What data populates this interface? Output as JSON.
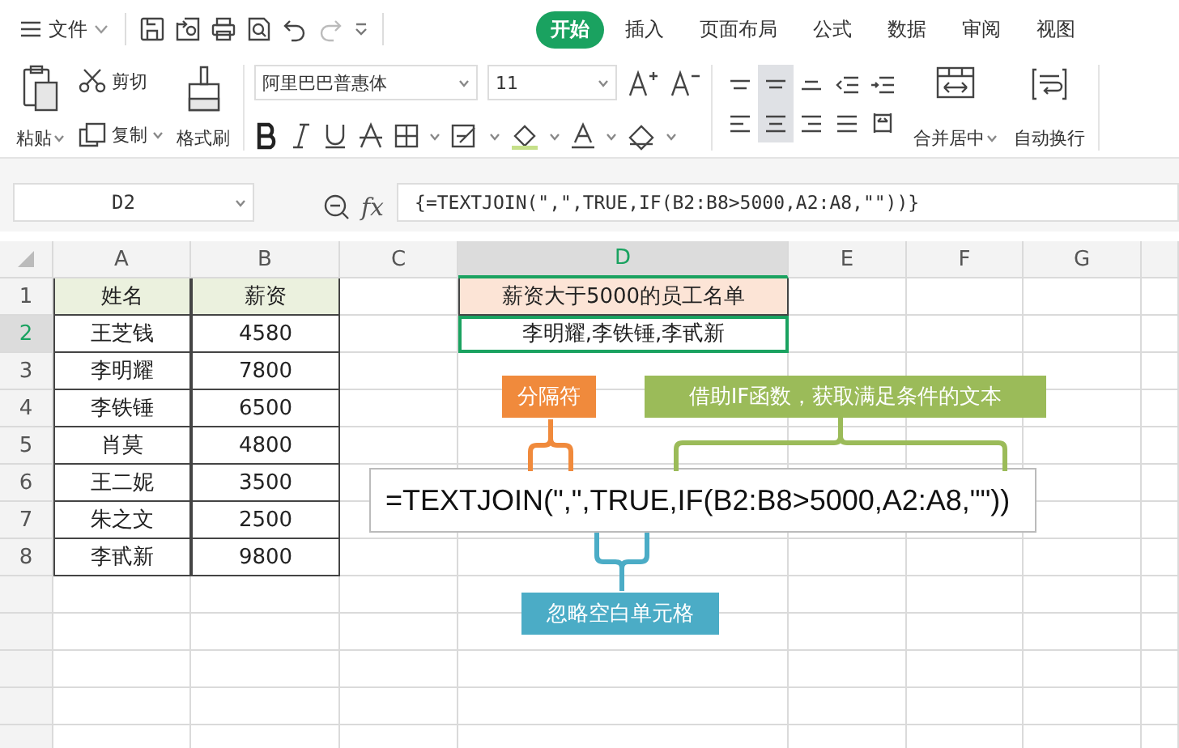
{
  "menu": {
    "file_label": "文件",
    "tabs": [
      {
        "label": "开始",
        "selected": true
      },
      {
        "label": "插入",
        "selected": false
      },
      {
        "label": "页面布局",
        "selected": false
      },
      {
        "label": "公式",
        "selected": false
      },
      {
        "label": "数据",
        "selected": false
      },
      {
        "label": "审阅",
        "selected": false
      },
      {
        "label": "视图",
        "selected": false
      }
    ]
  },
  "ribbon": {
    "paste": "粘贴",
    "cut": "剪切",
    "copy": "复制",
    "format_painter": "格式刷",
    "font_name": "阿里巴巴普惠体",
    "font_size": "11",
    "merge": "合并居中",
    "wrap": "自动换行",
    "align_buttons": [
      {
        "kind": "top",
        "selected": false
      },
      {
        "kind": "middle",
        "selected": true
      },
      {
        "kind": "bottom",
        "selected": false
      },
      {
        "kind": "outdent",
        "selected": false
      },
      {
        "kind": "indent",
        "selected": false
      },
      {
        "kind": "left",
        "selected": false
      },
      {
        "kind": "center",
        "selected": true
      },
      {
        "kind": "right",
        "selected": false
      },
      {
        "kind": "justify",
        "selected": false
      },
      {
        "kind": "distribute",
        "selected": false
      }
    ]
  },
  "formula_bar": {
    "cell_ref": "D2",
    "fx": "fx",
    "formula": "{=TEXTJOIN(\",\",TRUE,IF(B2:B8>5000,A2:A8,\"\"))}"
  },
  "sheet": {
    "columns": [
      {
        "label": "A",
        "selected": false
      },
      {
        "label": "B",
        "selected": false
      },
      {
        "label": "C",
        "selected": false
      },
      {
        "label": "D",
        "selected": true
      },
      {
        "label": "E",
        "selected": false
      },
      {
        "label": "F",
        "selected": false
      },
      {
        "label": "G",
        "selected": false
      }
    ],
    "rows": [
      {
        "number": "1",
        "selected": false,
        "cells": {
          "A": {
            "text": "姓名",
            "kind": "header",
            "selected": false
          },
          "B": {
            "text": "薪资",
            "kind": "header",
            "selected": false
          },
          "D": {
            "text": "薪资大于5000的员工名单",
            "kind": "title",
            "selected": false
          }
        }
      },
      {
        "number": "2",
        "selected": true,
        "cells": {
          "A": {
            "text": "王芝钱",
            "kind": "value",
            "selected": false
          },
          "B": {
            "text": "4580",
            "kind": "value",
            "selected": false
          },
          "D": {
            "text": "李明耀,李铁锤,李甙新",
            "kind": "value",
            "selected": true
          }
        }
      },
      {
        "number": "3",
        "selected": false,
        "cells": {
          "A": {
            "text": "李明耀",
            "kind": "value",
            "selected": false
          },
          "B": {
            "text": "7800",
            "kind": "value",
            "selected": false
          }
        }
      },
      {
        "number": "4",
        "selected": false,
        "cells": {
          "A": {
            "text": "李铁锤",
            "kind": "value",
            "selected": false
          },
          "B": {
            "text": "6500",
            "kind": "value",
            "selected": false
          }
        }
      },
      {
        "number": "5",
        "selected": false,
        "cells": {
          "A": {
            "text": "肖莫",
            "kind": "value",
            "selected": false
          },
          "B": {
            "text": "4800",
            "kind": "value",
            "selected": false
          }
        }
      },
      {
        "number": "6",
        "selected": false,
        "cells": {
          "A": {
            "text": "王二妮",
            "kind": "value",
            "selected": false
          },
          "B": {
            "text": "3500",
            "kind": "value",
            "selected": false
          }
        }
      },
      {
        "number": "7",
        "selected": false,
        "cells": {
          "A": {
            "text": "朱之文",
            "kind": "value",
            "selected": false
          },
          "B": {
            "text": "2500",
            "kind": "value",
            "selected": false
          }
        }
      },
      {
        "number": "8",
        "selected": false,
        "cells": {
          "A": {
            "text": "李甙新",
            "kind": "value",
            "selected": false
          },
          "B": {
            "text": "9800",
            "kind": "value",
            "selected": false
          }
        }
      }
    ]
  },
  "annotation": {
    "formula": "=TEXTJOIN(\",\",TRUE,IF(B2:B8>5000,A2:A8,\"\"))",
    "notes": [
      {
        "kind": "above",
        "text": "分隔符",
        "color": "#f08a3c"
      },
      {
        "kind": "above",
        "text": "借助IF函数，获取满足条件的文本",
        "color": "#9bbb59"
      },
      {
        "kind": "below",
        "text": "忽略空白单元格",
        "color": "#4bacc6"
      }
    ]
  }
}
